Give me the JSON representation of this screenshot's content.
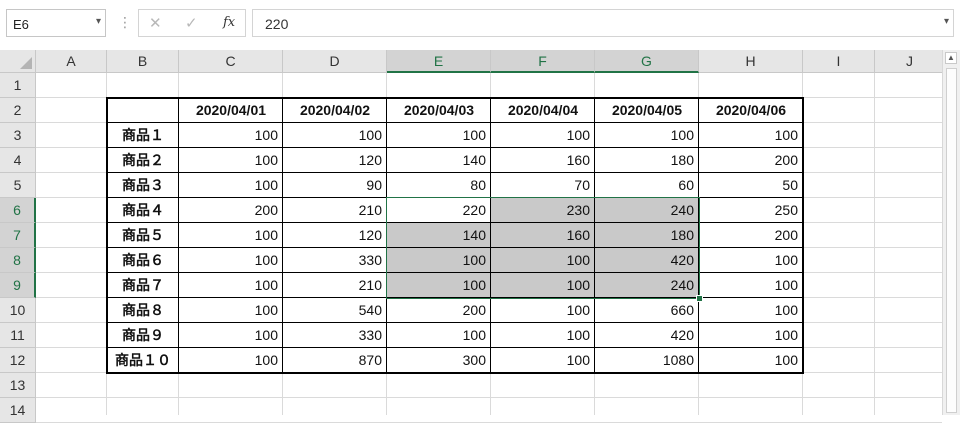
{
  "formula_bar": {
    "name_box": "E6",
    "separator": "⋮",
    "cancel_glyph": "✕",
    "enter_glyph": "✓",
    "fx_glyph": "fx",
    "value": "220"
  },
  "columns": [
    "A",
    "B",
    "C",
    "D",
    "E",
    "F",
    "G",
    "H",
    "I",
    "J"
  ],
  "rows": [
    "1",
    "2",
    "3",
    "4",
    "5",
    "6",
    "7",
    "8",
    "9",
    "10",
    "11",
    "12",
    "13",
    "14"
  ],
  "selected_columns": [
    "E",
    "F",
    "G"
  ],
  "selected_rows": [
    "6",
    "7",
    "8",
    "9"
  ],
  "table": {
    "header_row": [
      "2020/04/01",
      "2020/04/02",
      "2020/04/03",
      "2020/04/04",
      "2020/04/05",
      "2020/04/06"
    ],
    "rows": [
      {
        "label": "商品１",
        "values": [
          "100",
          "100",
          "100",
          "100",
          "100",
          "100"
        ]
      },
      {
        "label": "商品２",
        "values": [
          "100",
          "120",
          "140",
          "160",
          "180",
          "200"
        ]
      },
      {
        "label": "商品３",
        "values": [
          "100",
          "90",
          "80",
          "70",
          "60",
          "50"
        ]
      },
      {
        "label": "商品４",
        "values": [
          "200",
          "210",
          "220",
          "230",
          "240",
          "250"
        ]
      },
      {
        "label": "商品５",
        "values": [
          "100",
          "120",
          "140",
          "160",
          "180",
          "200"
        ]
      },
      {
        "label": "商品６",
        "values": [
          "100",
          "330",
          "100",
          "100",
          "420",
          "100"
        ]
      },
      {
        "label": "商品７",
        "values": [
          "100",
          "210",
          "100",
          "100",
          "240",
          "100"
        ]
      },
      {
        "label": "商品８",
        "values": [
          "100",
          "540",
          "200",
          "100",
          "660",
          "100"
        ]
      },
      {
        "label": "商品９",
        "values": [
          "100",
          "330",
          "100",
          "100",
          "420",
          "100"
        ]
      },
      {
        "label": "商品１０",
        "values": [
          "100",
          "870",
          "300",
          "100",
          "1080",
          "100"
        ]
      }
    ]
  },
  "scrollbar": {
    "up_glyph": "▲"
  },
  "colors": {
    "selection": "#217346",
    "shade": "#c9c9c9"
  }
}
